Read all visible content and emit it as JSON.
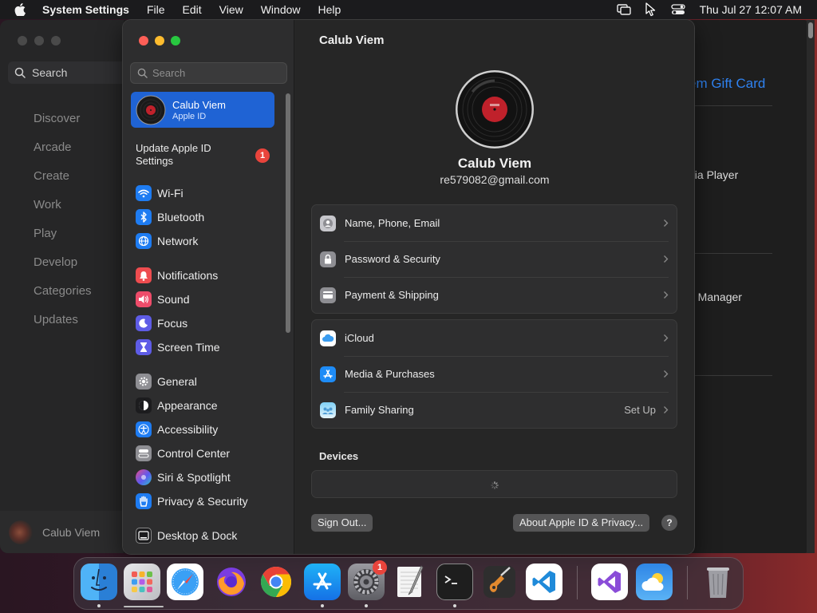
{
  "menubar": {
    "app_name": "System Settings",
    "menus": [
      "File",
      "Edit",
      "View",
      "Window",
      "Help"
    ],
    "clock": "Thu Jul 27  12:07 AM"
  },
  "background_window": {
    "search_label": "Search",
    "nav": [
      "Discover",
      "Arcade",
      "Create",
      "Work",
      "Play",
      "Develop",
      "Categories",
      "Updates"
    ],
    "user_name": "Calub Viem",
    "link_text": "em Gift Card",
    "text_1": "dia Player",
    "text_2": "d Manager"
  },
  "settings": {
    "search_placeholder": "Search",
    "apple_id": {
      "name": "Calub Viem",
      "sub": "Apple ID"
    },
    "update": {
      "label": "Update Apple ID Settings",
      "badge": "1"
    },
    "groups": [
      [
        {
          "label": "Wi-Fi",
          "icon": "wifi-icon",
          "color": "#1e7cf2"
        },
        {
          "label": "Bluetooth",
          "icon": "bluetooth-icon",
          "color": "#1e7cf2"
        },
        {
          "label": "Network",
          "icon": "globe-icon",
          "color": "#1e7cf2"
        }
      ],
      [
        {
          "label": "Notifications",
          "icon": "bell-icon",
          "color": "#ee4c4f"
        },
        {
          "label": "Sound",
          "icon": "speaker-icon",
          "color": "#ee4c6a"
        },
        {
          "label": "Focus",
          "icon": "moon-icon",
          "color": "#5e5ce6"
        },
        {
          "label": "Screen Time",
          "icon": "hourglass-icon",
          "color": "#5e5ce6"
        }
      ],
      [
        {
          "label": "General",
          "icon": "gear-icon",
          "color": "#8e8e93"
        },
        {
          "label": "Appearance",
          "icon": "appearance-icon",
          "color": "#1c1c1e"
        },
        {
          "label": "Accessibility",
          "icon": "accessibility-icon",
          "color": "#1e7cf2"
        },
        {
          "label": "Control Center",
          "icon": "control-center-icon",
          "color": "#8e8e93"
        },
        {
          "label": "Siri & Spotlight",
          "icon": "siri-icon",
          "color": "#b04cd8"
        },
        {
          "label": "Privacy & Security",
          "icon": "hand-icon",
          "color": "#1e7cf2"
        }
      ],
      [
        {
          "label": "Desktop & Dock",
          "icon": "dock-icon",
          "color": "#1c1c1e"
        }
      ]
    ]
  },
  "main": {
    "title": "Calub Viem",
    "profile_name": "Calub Viem",
    "email": "re579082@gmail.com",
    "card1": [
      {
        "label": "Name, Phone, Email",
        "icon": "person-icon",
        "value": ""
      },
      {
        "label": "Password & Security",
        "icon": "lock-icon",
        "value": ""
      },
      {
        "label": "Payment & Shipping",
        "icon": "creditcard-icon",
        "value": ""
      }
    ],
    "card2": [
      {
        "label": "iCloud",
        "icon": "icloud-icon",
        "value": ""
      },
      {
        "label": "Media & Purchases",
        "icon": "appstore-icon",
        "value": ""
      },
      {
        "label": "Family Sharing",
        "icon": "family-icon",
        "value": "Set Up"
      }
    ],
    "devices_title": "Devices",
    "sign_out": "Sign Out...",
    "about": "About Apple ID & Privacy...",
    "help": "?"
  },
  "dock": {
    "badge": "1",
    "apps": [
      "Finder",
      "Launchpad",
      "Safari",
      "Firefox",
      "Chrome",
      "App Store",
      "System Settings",
      "TextEdit",
      "Terminal",
      "GarageBand",
      "Visual Studio Code",
      "Visual Studio",
      "Weather",
      "Trash"
    ]
  },
  "colors": {
    "accent": "#1f63d4",
    "badge": "#e9443c",
    "link": "#2f82f0"
  }
}
